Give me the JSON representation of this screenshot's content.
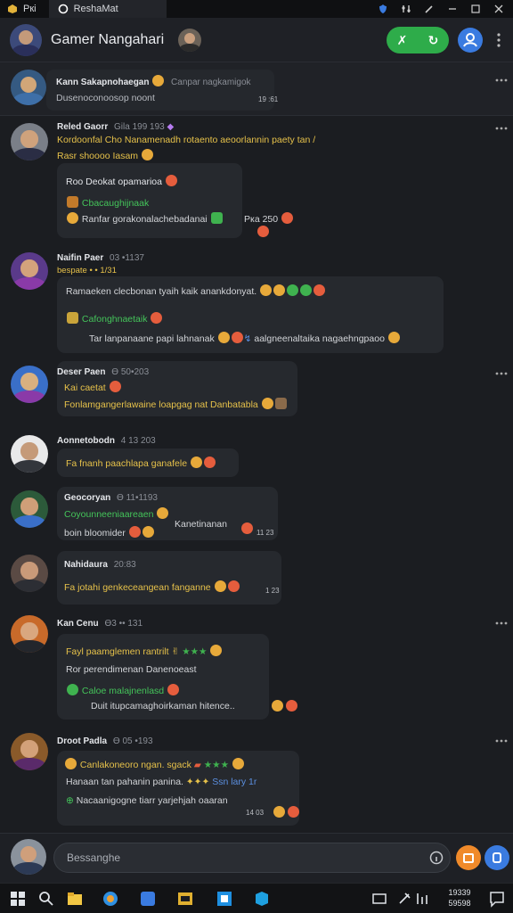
{
  "titlebar": {
    "app_label": "Ркі",
    "tab_label": "ReshaMat"
  },
  "header": {
    "title": "Gamer Nangahari"
  },
  "pinned": {
    "name": "Kann Sakapnohaegan",
    "status": "Canpar nagkamigok",
    "text": "Dusenoconoosop noont",
    "time": "19 :61"
  },
  "messages": [
    {
      "name": "Reled Gaorr",
      "meta": "Gila 199 193",
      "lines": [
        {
          "text": "Kordoonfal Cho  Nanamenadh rotaento aeoorlannin paety tan /",
          "color": "yellow"
        },
        {
          "text": "Rasr shoooo  Iasam",
          "color": "yellow"
        }
      ],
      "bubble_lines": [
        {
          "text": "Roo Deokat opamarioa",
          "color": "yellow"
        },
        {
          "text": "Cbacaughijnaak",
          "color": "green"
        },
        {
          "text": "Ranfar gorakonalachebadanai",
          "color": "white"
        }
      ],
      "after": "Рка 250"
    },
    {
      "name": "Naifin Paer",
      "meta": "03 •1137",
      "sub": "bespate  • • 1/31",
      "lines": [
        {
          "text": "Ramaeken  clecbonan tyaih kaik anankdonyat.",
          "color": "white"
        },
        {
          "text": "Cafonghnaetaik",
          "color": "green"
        },
        {
          "text": "Tar lanpanaane papi lahnanak",
          "color": "white"
        },
        {
          "text": "aalgneenaltaika nagaehngpaoo",
          "color": "white"
        }
      ]
    },
    {
      "name": "Deser Paen",
      "meta": "Ө 50•203",
      "lines": [
        {
          "text": "Kai caetat",
          "color": "yellow"
        },
        {
          "text": "Fonlamgangerlawaine loapgag nat Danbatabla",
          "color": "yellow"
        }
      ]
    },
    {
      "name": "Aonnetobodn",
      "meta": "4 13 203",
      "lines": [
        {
          "text": "Fa fnanh paachlapa ganafele",
          "color": "yellow"
        }
      ]
    },
    {
      "name": "Geocoryan",
      "meta": "Ө 11•1193",
      "lines": [
        {
          "text": "Coyounneeniaareaen",
          "color": "green"
        },
        {
          "text": "Kanetinanan",
          "color": "white"
        },
        {
          "text": "boin bloomider",
          "color": "white"
        }
      ],
      "time": "11 23"
    },
    {
      "name": "Nahidaura",
      "meta": "20:83",
      "lines": [
        {
          "text": "Fa jotahi genkeceangean fanganne",
          "color": "yellow"
        }
      ],
      "time": "1 23"
    },
    {
      "name": "Kan Cenu",
      "meta": "Ө3 •• 131",
      "lines": [
        {
          "text": "Fayl paamglemen rantrilt",
          "color": "yellow"
        },
        {
          "text": "Ror perendimenan Danenoeast",
          "color": "white"
        },
        {
          "text": "Caloe malajnenlasd",
          "color": "green"
        },
        {
          "text": "Duit itupcamaghoirkaman hitence..",
          "color": "white"
        }
      ]
    },
    {
      "name": "Droot Padla",
      "meta": "Ө 05 •193",
      "lines": [
        {
          "text": "Canlakoneoro ngan. sgack",
          "color": "yellow"
        },
        {
          "text": "Hanaan tan pahanin panina.",
          "color": "white"
        },
        {
          "text": "Ssn lary 1r",
          "color": "blue"
        },
        {
          "text": "Nacaanigogne tiarr yarjehjah oaaran",
          "color": "white"
        }
      ],
      "time": "14 03"
    }
  ],
  "composer": {
    "placeholder": "Bessanghe"
  },
  "taskbar": {
    "clock_time": "19339",
    "clock_date": "59598"
  },
  "colors": {
    "accent_green": "#2eac4a",
    "accent_blue": "#3a7be0",
    "accent_orange": "#f08a2a",
    "text_yellow": "#e6c14a",
    "text_green": "#44c45a"
  }
}
